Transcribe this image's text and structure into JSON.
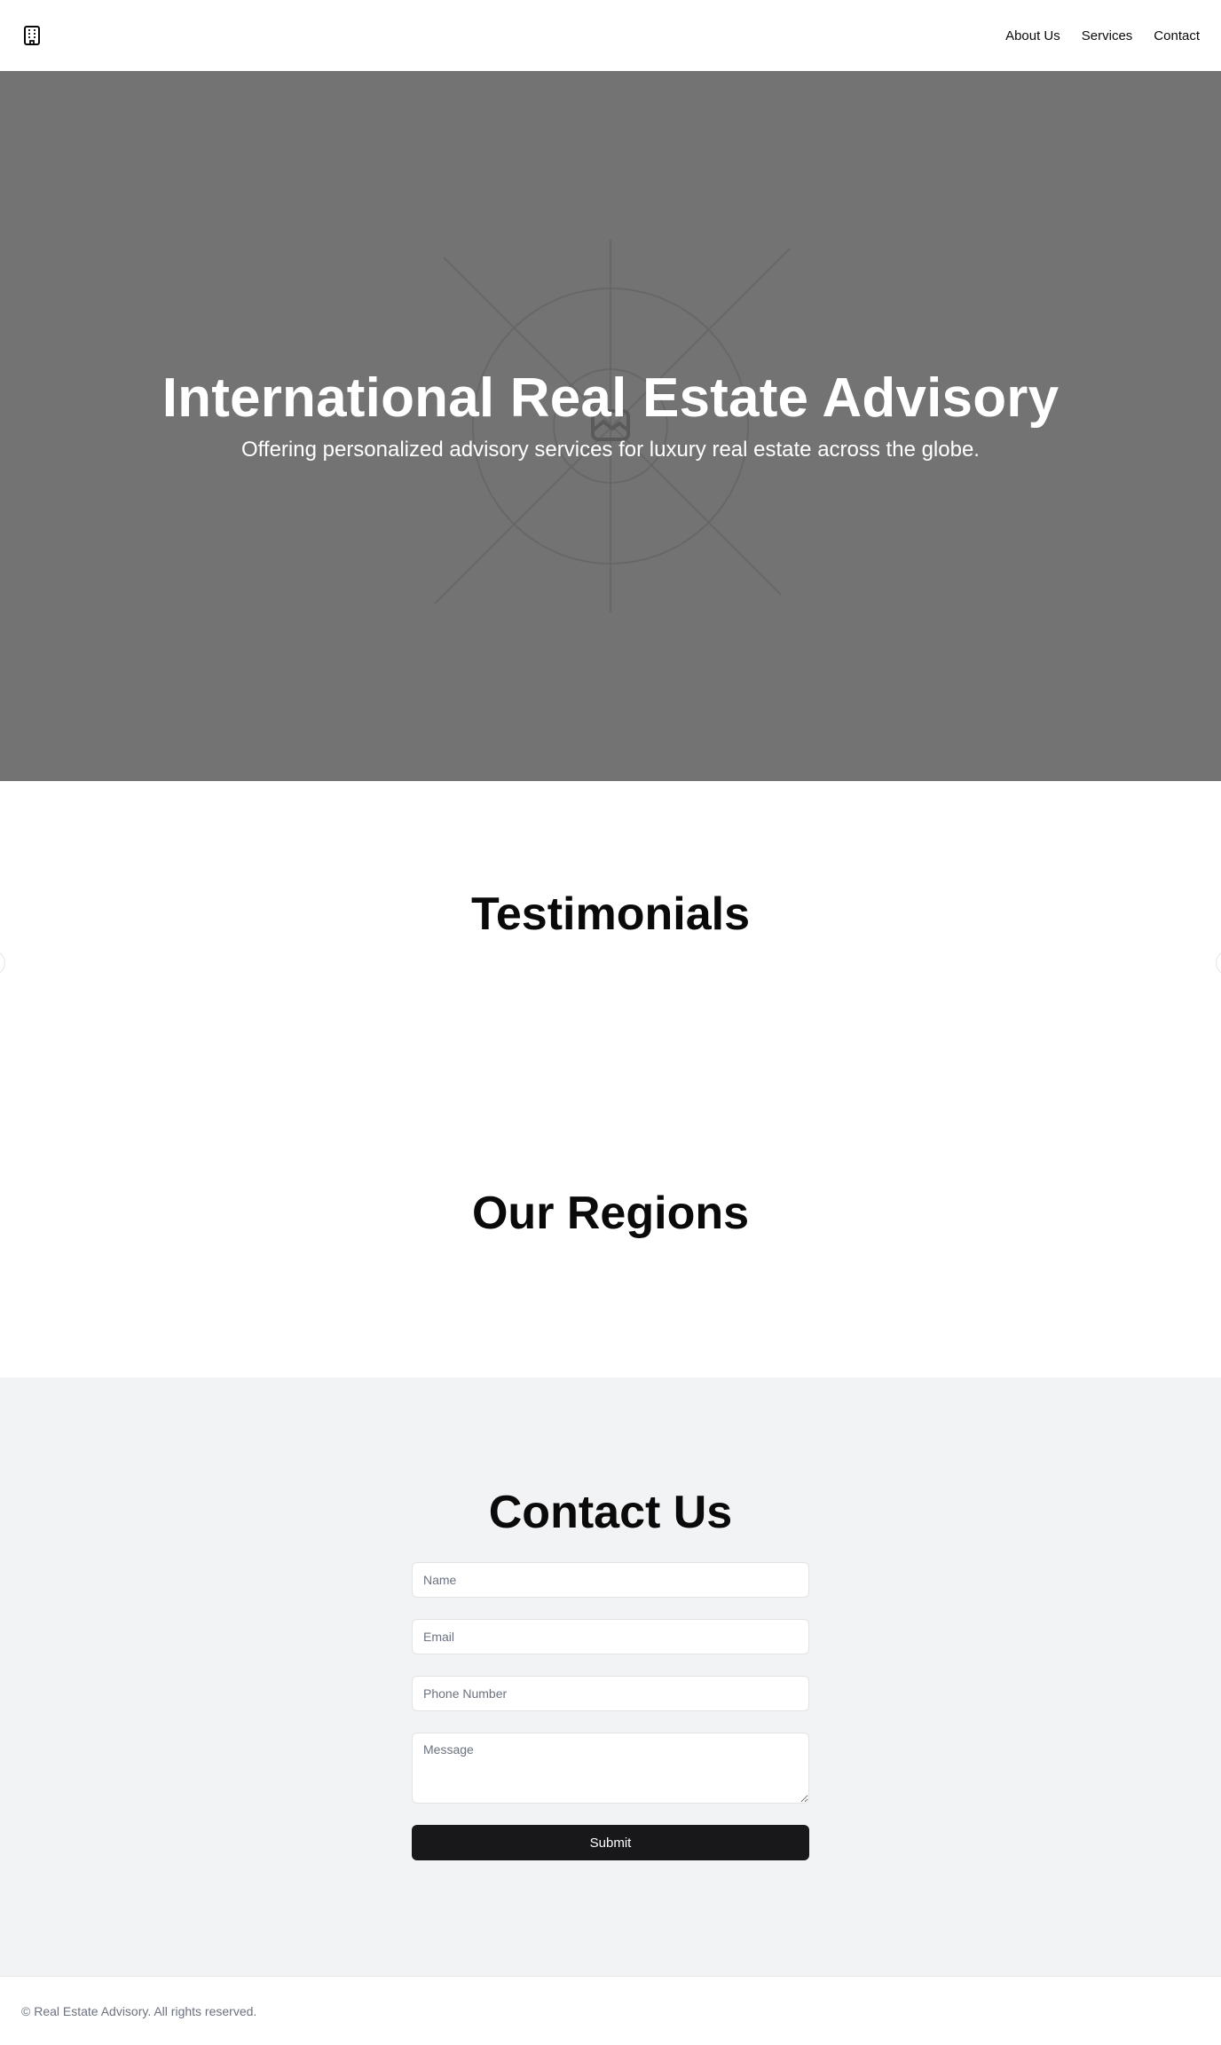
{
  "header": {
    "logo_icon": "building-icon",
    "nav": [
      {
        "label": "About Us"
      },
      {
        "label": "Services"
      },
      {
        "label": "Contact"
      }
    ]
  },
  "hero": {
    "title": "International Real Estate Advisory",
    "subtitle": "Offering personalized advisory services for luxury real estate across the globe.",
    "background_color": "#737373",
    "image_icon": "image-placeholder-icon"
  },
  "testimonials": {
    "title": "Testimonials",
    "prev_icon": "chevron-left-icon",
    "next_icon": "chevron-right-icon"
  },
  "regions": {
    "title": "Our Regions"
  },
  "contact": {
    "title": "Contact Us",
    "name_placeholder": "Name",
    "email_placeholder": "Email",
    "phone_placeholder": "Phone Number",
    "message_placeholder": "Message",
    "submit_label": "Submit",
    "background_color": "#f2f3f5",
    "button_color": "#18181b"
  },
  "footer": {
    "text": "© Real Estate Advisory. All rights reserved."
  }
}
